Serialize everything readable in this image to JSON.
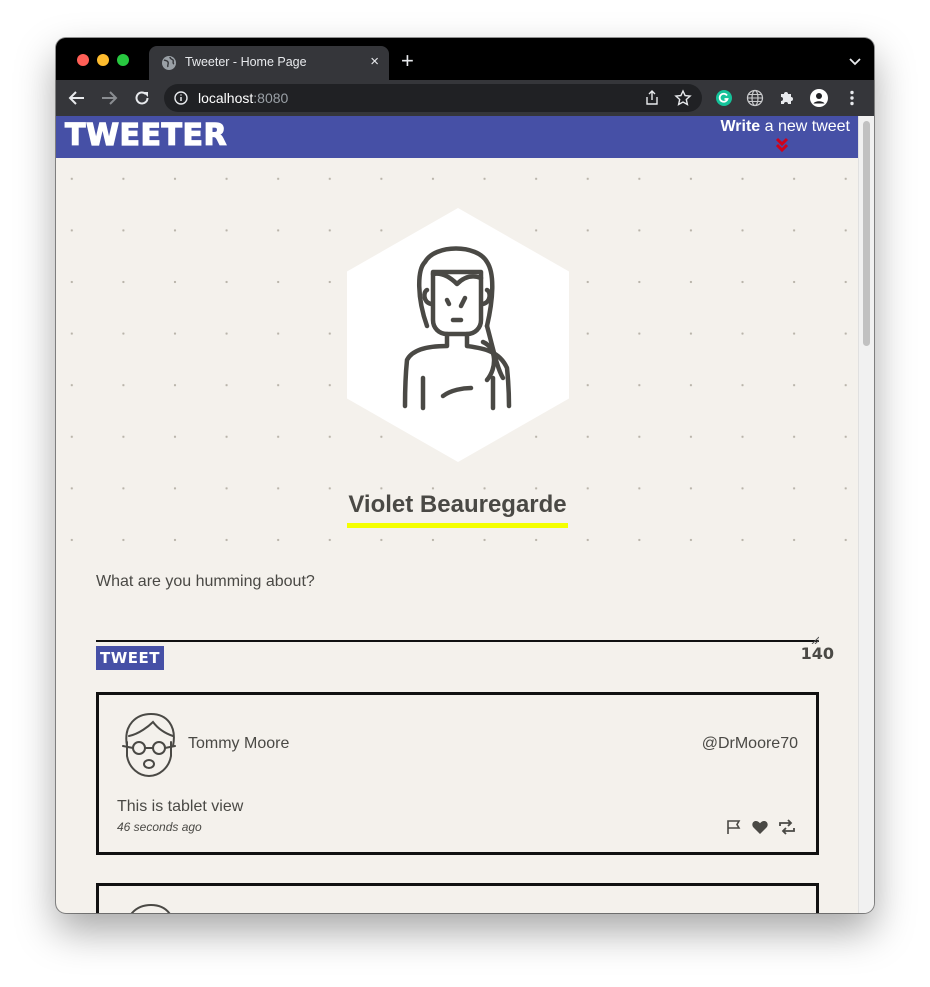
{
  "browser": {
    "tab_title": "Tweeter - Home Page",
    "tab_close": "×",
    "new_tab": "+",
    "url_host": "localhost",
    "url_port": ":8080"
  },
  "navbar": {
    "brand": "TWEETER",
    "write_bold": "Write",
    "write_rest": " a new tweet"
  },
  "profile": {
    "name": "Violet Beauregarde"
  },
  "composer": {
    "placeholder": "What are you humming about?",
    "button": "TWEET",
    "counter": "140"
  },
  "tweets": [
    {
      "name": "Tommy Moore",
      "handle": "@DrMoore70",
      "text": "This is tablet view",
      "time": "46 seconds ago"
    }
  ],
  "colors": {
    "nav": "#4650a6",
    "accent_underline": "#f4ff00",
    "chevron": "#d0021b",
    "page_bg": "#f4f1ec"
  }
}
